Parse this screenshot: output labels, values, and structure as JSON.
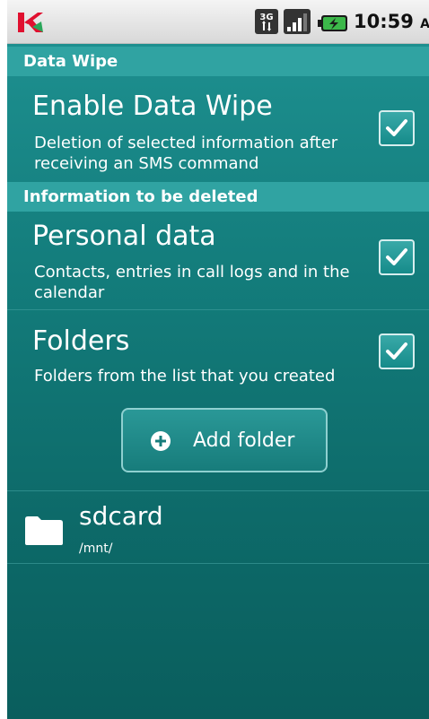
{
  "status_bar": {
    "time": "10:59",
    "ampm": "AM",
    "network_type": "3G",
    "icons": [
      "kaspersky-logo",
      "3g-network-icon",
      "signal-icon",
      "battery-charging-icon"
    ]
  },
  "data_wipe": {
    "header": "Data Wipe",
    "enable": {
      "title": "Enable Data Wipe",
      "description": "Deletion of selected information after receiving an SMS command",
      "checked": true
    }
  },
  "info_to_delete": {
    "header": "Information to be deleted",
    "personal": {
      "title": "Personal data",
      "description": "Contacts, entries in call logs and in the calendar",
      "checked": true
    },
    "folders": {
      "title": "Folders",
      "description": "Folders from the list that you created",
      "checked": true,
      "add_button_label": "Add folder"
    }
  },
  "folder_list": [
    {
      "name": "sdcard",
      "path": "/mnt/"
    }
  ],
  "colors": {
    "background": "#137c7b",
    "header": "#30a3a2",
    "text": "#ffffff"
  }
}
